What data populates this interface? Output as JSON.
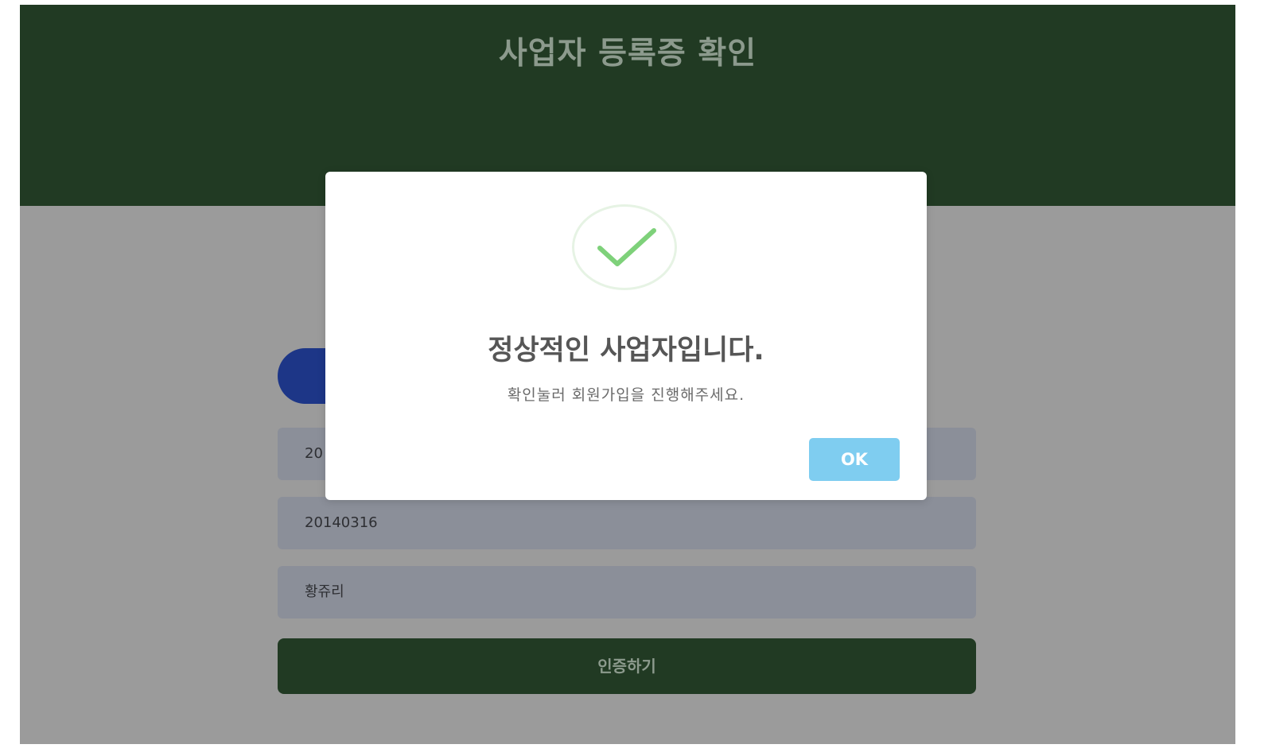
{
  "header": {
    "title": "사업자 등록증 확인"
  },
  "form": {
    "field_1_value": "20",
    "field_2_value": "20140316",
    "field_3_value": "황쥬리",
    "submit_label": "인증하기"
  },
  "dialog": {
    "icon": "check-icon",
    "title": "정상적인 사업자입니다.",
    "message": "확인눌러 회원가입을 진행해주세요.",
    "ok_label": "OK"
  },
  "colors": {
    "header_bg": "#213a23",
    "overlay_bg": "#9b9b9b",
    "check_green": "#7ed17a",
    "ok_button": "#7fcdf0",
    "tab_blue": "#1d3687"
  }
}
